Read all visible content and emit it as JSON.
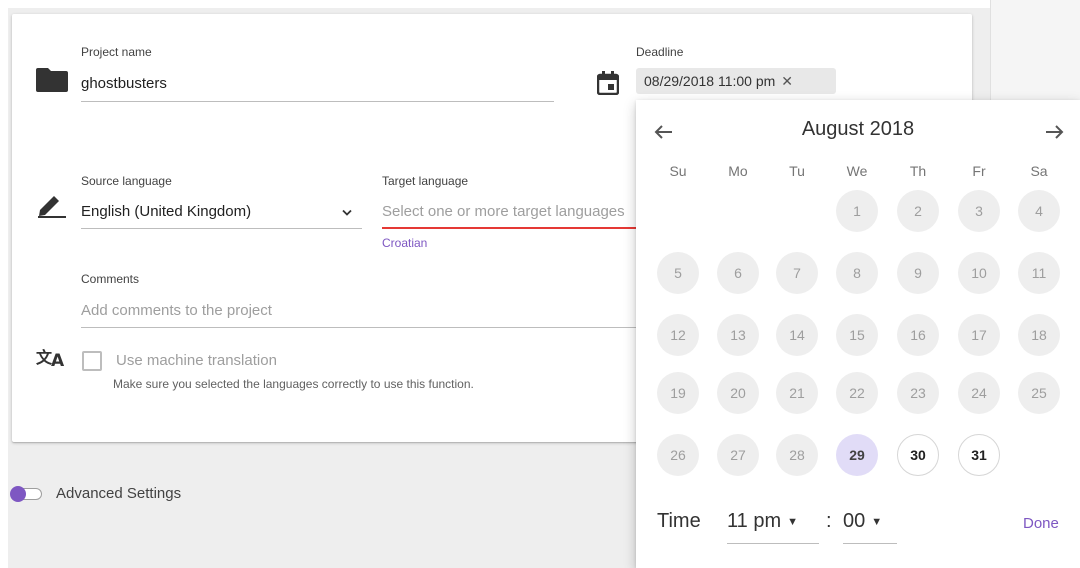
{
  "form": {
    "project_name": {
      "label": "Project name",
      "value": "ghostbusters"
    },
    "deadline": {
      "label": "Deadline",
      "value": "08/29/2018 11:00 pm",
      "clear_icon": "close-icon"
    },
    "source_language": {
      "label": "Source language",
      "value": "English (United Kingdom)"
    },
    "target_language": {
      "label": "Target language",
      "placeholder": "Select one or more target languages",
      "hint": "Croatian"
    },
    "comments": {
      "label": "Comments",
      "placeholder": "Add comments to the project"
    },
    "machine_translation": {
      "label": "Use machine translation",
      "hint": "Make sure you selected the languages correctly to use this function.",
      "checked": false
    }
  },
  "advanced_settings": {
    "label": "Advanced Settings"
  },
  "datepicker": {
    "month_title": "August 2018",
    "weekdays": [
      "Su",
      "Mo",
      "Tu",
      "We",
      "Th",
      "Fr",
      "Sa"
    ],
    "weeks": [
      [
        "",
        "",
        "",
        "1",
        "2",
        "3",
        "4"
      ],
      [
        "5",
        "6",
        "7",
        "8",
        "9",
        "10",
        "11"
      ],
      [
        "12",
        "13",
        "14",
        "15",
        "16",
        "17",
        "18"
      ],
      [
        "19",
        "20",
        "21",
        "22",
        "23",
        "24",
        "25"
      ],
      [
        "26",
        "27",
        "28",
        "29",
        "30",
        "31",
        ""
      ]
    ],
    "selected_day": "29",
    "enabled_days": [
      "30",
      "31"
    ],
    "time_label": "Time",
    "hour": "11 pm",
    "minute": "00",
    "colon": ":",
    "done_label": "Done"
  },
  "colors": {
    "accent": "#7e57c2",
    "error_underline": "#e53935",
    "selected_day_bg": "#e1dcf7"
  },
  "icons": {
    "project": "folder-icon",
    "deadline": "calendar-icon",
    "source_language": "pencil-icon",
    "machine_translation": "translate-icon",
    "prev_month": "arrow-left-icon",
    "next_month": "arrow-right-icon"
  }
}
